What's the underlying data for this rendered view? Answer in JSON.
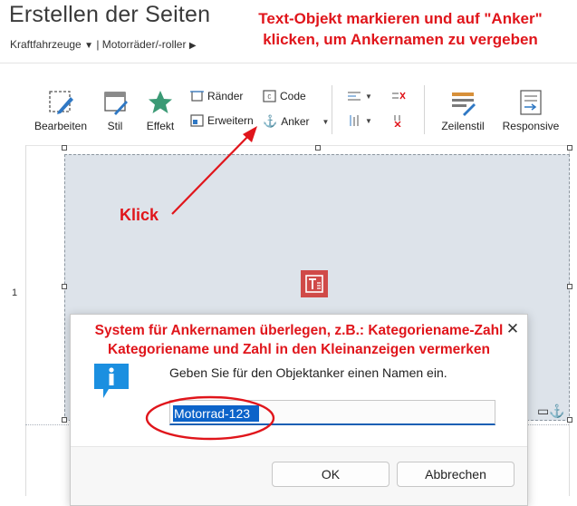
{
  "header": {
    "title": "Erstellen der Seiten",
    "breadcrumb": [
      "Kraftfahrzeuge",
      "Motorräder/-roller"
    ],
    "breadcrumb_separator": "|"
  },
  "annotations": {
    "top_line1": "Text-Objekt markieren und auf \"Anker\"",
    "top_line2": "klicken, um Ankernamen zu vergeben",
    "klick": "Klick",
    "dialog_line1": "System für Ankernamen überlegen, z.B.: Kategoriename-Zahl",
    "dialog_line2": "Kategoriename und Zahl in den Kleinanzeigen vermerken",
    "color": "#e0151b"
  },
  "toolbar": {
    "bearbeiten": "Bearbeiten",
    "stil": "Stil",
    "effekt": "Effekt",
    "raender": "Ränder",
    "code": "Code",
    "erweitern": "Erweitern",
    "anker": "Anker",
    "zeilenstil": "Zeilenstil",
    "responsive": "Responsive"
  },
  "editor": {
    "row_number": "1"
  },
  "dialog": {
    "prompt": "Geben Sie für den Objektanker einen Namen ein.",
    "input_value": "Motorrad-123",
    "ok_label": "OK",
    "cancel_label": "Abbrechen",
    "close_glyph": "✕"
  },
  "colors": {
    "accent_blue": "#1a5fb4",
    "info_icon": "#1b8fe0",
    "block_bg": "#dde3ea",
    "text_object_icon": "#d04a48"
  }
}
